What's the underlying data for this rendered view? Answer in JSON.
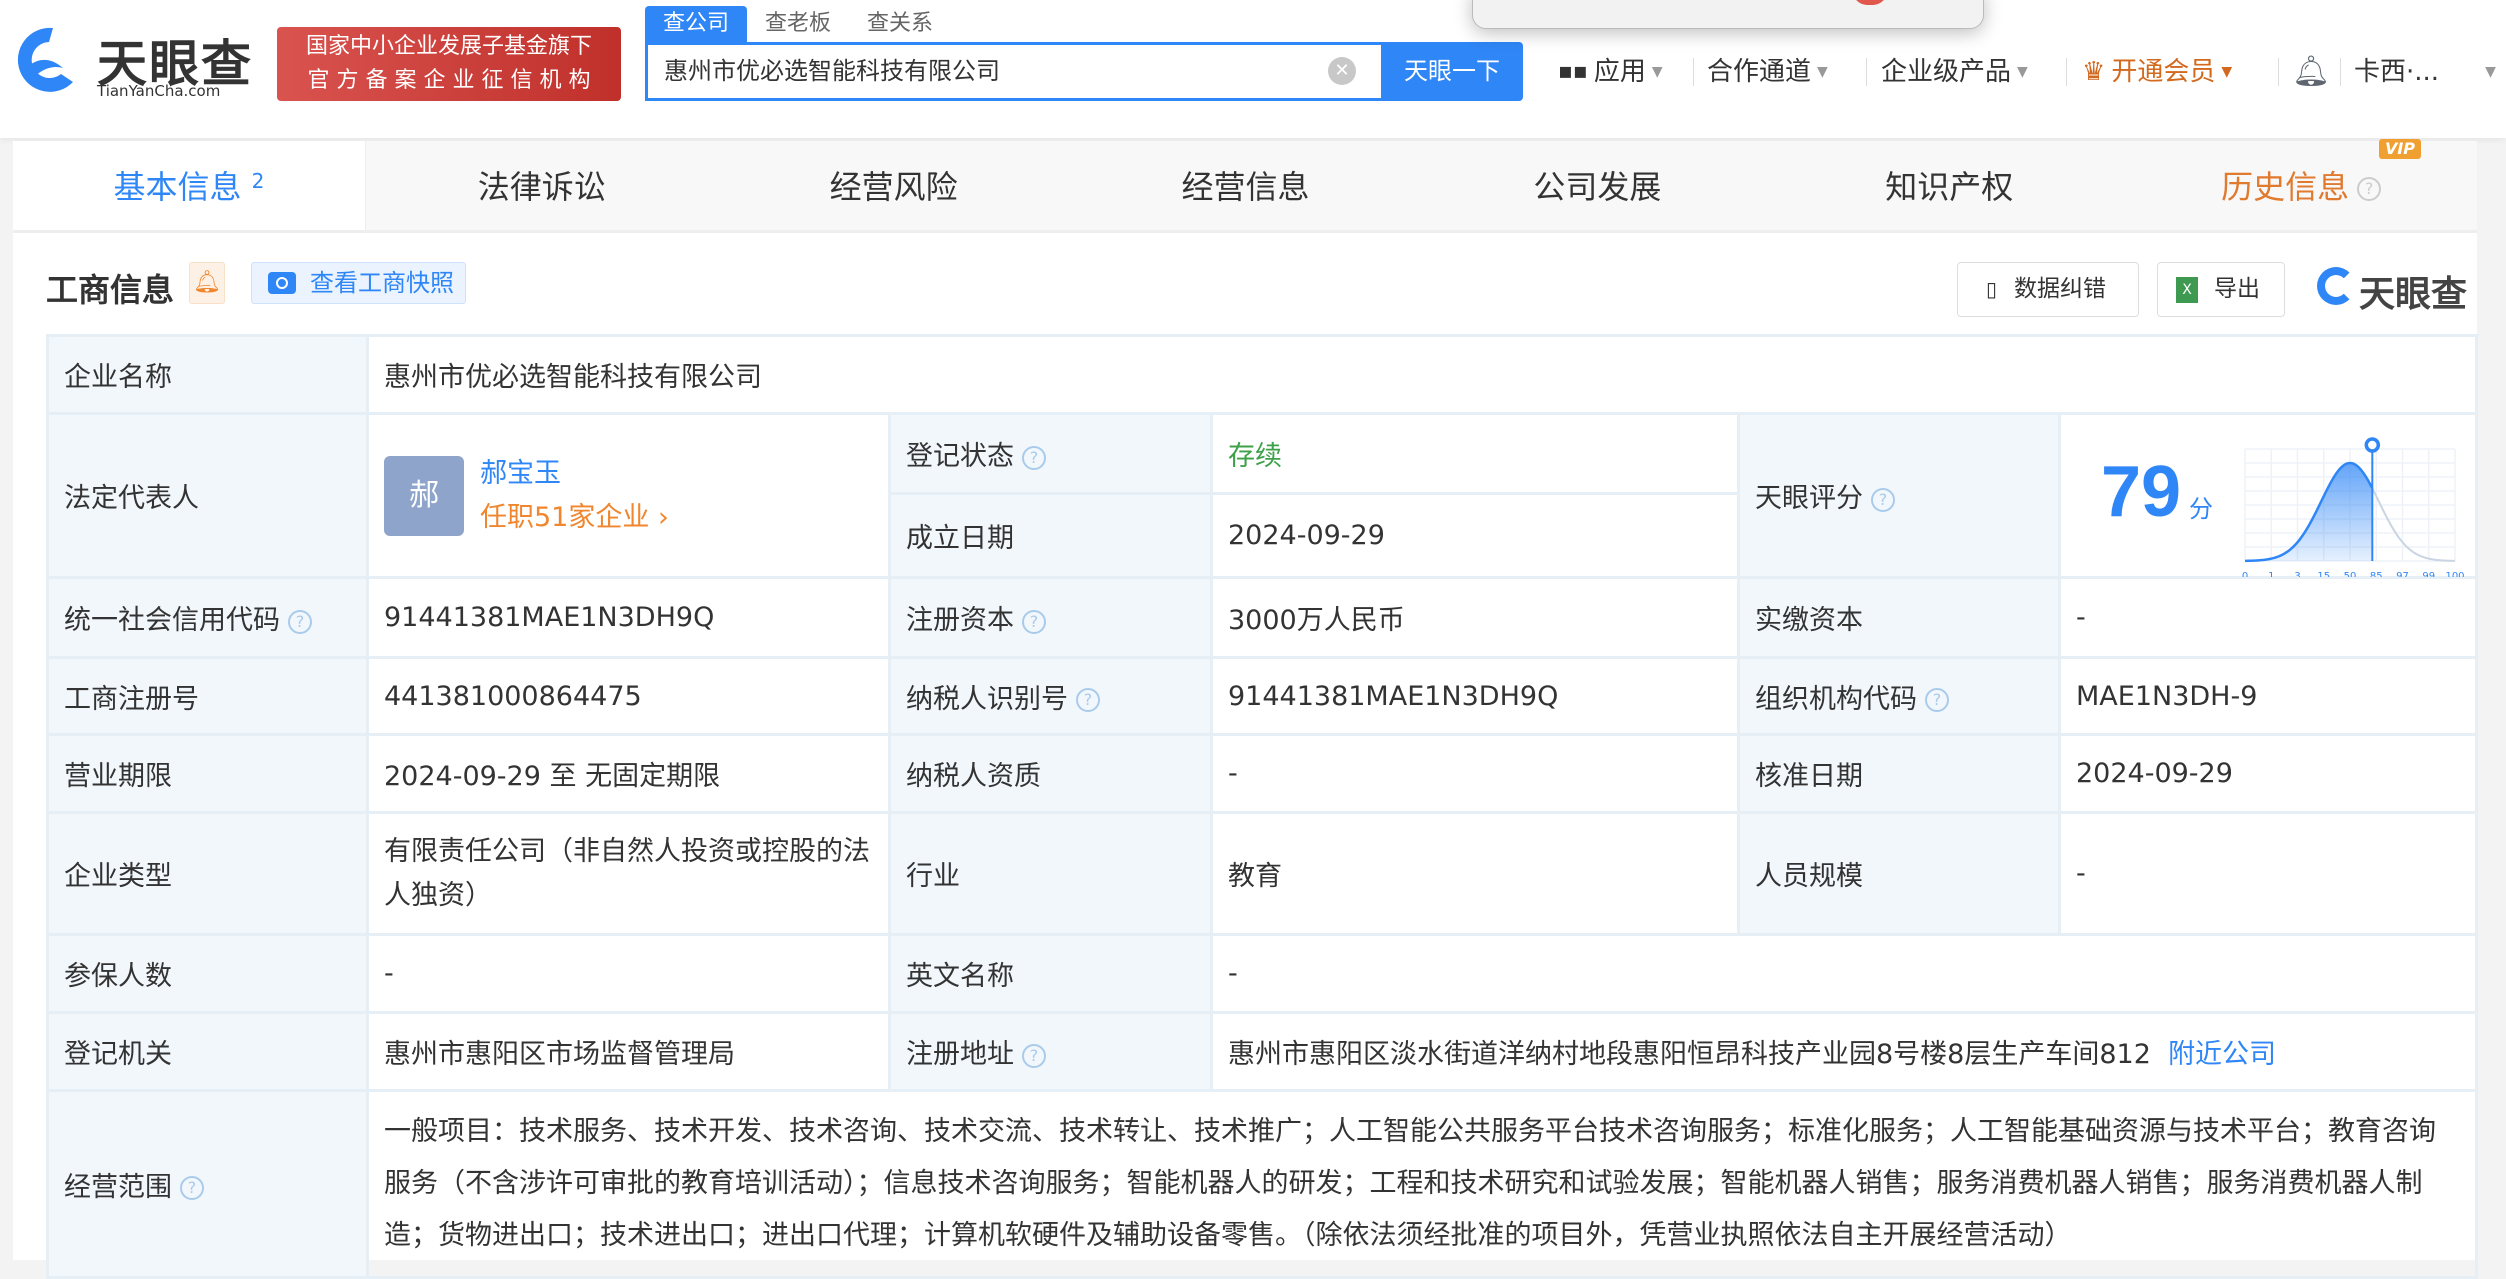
{
  "header": {
    "logo_text": "天眼查",
    "logo_domain": "TianYanCha.com",
    "badge_line1": "国家中小企业发展子基金旗下",
    "badge_line2": "官 方 备 案 企 业 征 信 机 构",
    "search_tabs": [
      "查公司",
      "查老板",
      "查关系"
    ],
    "search_value": "惠州市优必选智能科技有限公司",
    "search_button": "天眼一下",
    "nav": {
      "apps": "应用",
      "partner": "合作通道",
      "enterprise": "企业级产品",
      "vip": "开通会员",
      "user": "卡西·..."
    }
  },
  "tabs": [
    {
      "label": "基本信息",
      "count": "2"
    },
    {
      "label": "法律诉讼"
    },
    {
      "label": "经营风险"
    },
    {
      "label": "经营信息"
    },
    {
      "label": "公司发展"
    },
    {
      "label": "知识产权"
    },
    {
      "label": "历史信息",
      "badge": "VIP"
    }
  ],
  "section": {
    "title": "工商信息",
    "snapshot_button": "查看工商快照",
    "correct_button": "数据纠错",
    "export_button": "导出",
    "brand": "天眼查"
  },
  "info": {
    "company_name_label": "企业名称",
    "company_name": "惠州市优必选智能科技有限公司",
    "legal_rep_label": "法定代表人",
    "legal_rep_avatar": "郝",
    "legal_rep": "郝宝玉",
    "legal_rep_jobs": "任职51家企业 ›",
    "status_label": "登记状态",
    "status": "存续",
    "founded_label": "成立日期",
    "founded": "2024-09-29",
    "score_label": "天眼评分",
    "score": "79",
    "score_unit": "分",
    "credit_code_label": "统一社会信用代码",
    "credit_code": "91441381MAE1N3DH9Q",
    "reg_capital_label": "注册资本",
    "reg_capital": "3000万人民币",
    "paid_capital_label": "实缴资本",
    "paid_capital": "-",
    "reg_no_label": "工商注册号",
    "reg_no": "441381000864475",
    "taxpayer_id_label": "纳税人识别号",
    "taxpayer_id": "91441381MAE1N3DH9Q",
    "org_code_label": "组织机构代码",
    "org_code": "MAE1N3DH-9",
    "term_label": "营业期限",
    "term": "2024-09-29 至 无固定期限",
    "taxpayer_qual_label": "纳税人资质",
    "taxpayer_qual": "-",
    "approved_label": "核准日期",
    "approved": "2024-09-29",
    "type_label": "企业类型",
    "type": "有限责任公司（非自然人投资或控股的法人独资）",
    "industry_label": "行业",
    "industry": "教育",
    "staff_label": "人员规模",
    "staff": "-",
    "insured_label": "参保人数",
    "insured": "-",
    "english_label": "英文名称",
    "english": "-",
    "authority_label": "登记机关",
    "authority": "惠州市惠阳区市场监督管理局",
    "address_label": "注册地址",
    "address": "惠州市惠阳区淡水街道洋纳村地段惠阳恒昂科技产业园8号楼8层生产车间812",
    "nearby": "附近公司",
    "scope_label": "经营范围",
    "scope": "一般项目：技术服务、技术开发、技术咨询、技术交流、技术转让、技术推广；人工智能公共服务平台技术咨询服务；标准化服务；人工智能基础资源与技术平台；教育咨询服务（不含涉许可审批的教育培训活动）；信息技术咨询服务；智能机器人的研发；工程和技术研究和试验发展；智能机器人销售；服务消费机器人销售；服务消费机器人制造；货物进出口；技术进出口；进出口代理；计算机软硬件及辅助设备零售。（除依法须经批准的项目外，凭营业执照依法自主开展经营活动）"
  },
  "chart_data": {
    "type": "area",
    "title": "天眼评分分布",
    "x_ticks": [
      "0",
      "1",
      "3",
      "15",
      "50",
      "85",
      "97",
      "99",
      "100"
    ],
    "score": 79,
    "grid": true,
    "colors": {
      "fill": "#2f86f6",
      "rest": "#c9d5e2"
    }
  }
}
